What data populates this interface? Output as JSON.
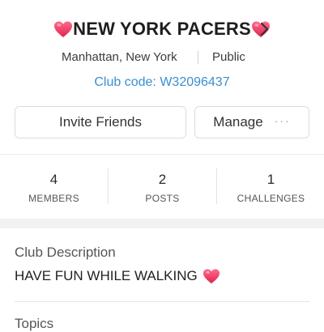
{
  "club": {
    "name": "NEW YORK PACERS",
    "location": "Manhattan, New York",
    "privacy": "Public",
    "code": "Club code: W32096437"
  },
  "actions": {
    "invite_label": "Invite Friends",
    "manage_label": "Manage",
    "manage_more": "···"
  },
  "stats": [
    {
      "value": "4",
      "label": "MEMBERS"
    },
    {
      "value": "2",
      "label": "POSTS"
    },
    {
      "value": "1",
      "label": "CHALLENGES"
    }
  ],
  "description": {
    "title": "Club Description",
    "text": "HAVE FUN WHILE WALKING"
  },
  "next_section": {
    "title": "Topics"
  },
  "icons": {
    "heart": "heart-icon",
    "chevron": "chevron-right-icon",
    "more": "more-dots-icon"
  },
  "colors": {
    "heart": "#e8345c",
    "link": "#3a8fd0",
    "band": "#f2f2f2"
  }
}
